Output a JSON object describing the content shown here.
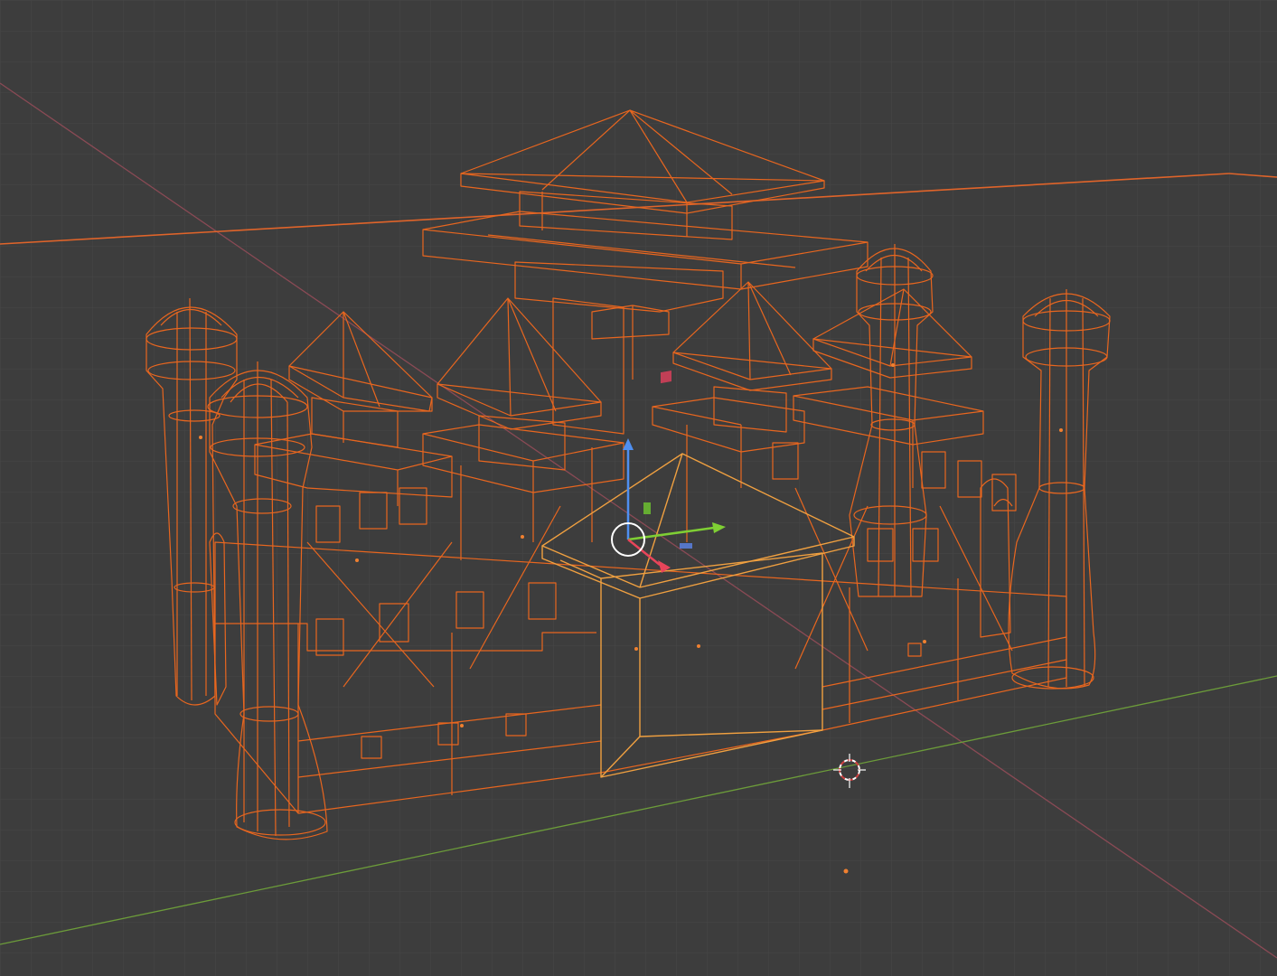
{
  "app": {
    "view": "3D Viewport",
    "shading": "wireframe"
  },
  "colors": {
    "background": "#3d3d3d",
    "grid": "#4a4a4a",
    "x_axis": "#b45a6a",
    "y_axis": "#86b845",
    "selection": "#e66a1e",
    "active_selection": "#f0a040",
    "gizmo_x": "#e8455a",
    "gizmo_y": "#7fcf34",
    "gizmo_z": "#4f8ff0",
    "gizmo_circle": "#ffffff"
  },
  "scene": {
    "object": "castle",
    "selected": true
  },
  "icons": {
    "gizmo": "transform-gizmo-icon",
    "cursor": "3d-cursor-icon",
    "origin": "origin-dot-icon"
  }
}
